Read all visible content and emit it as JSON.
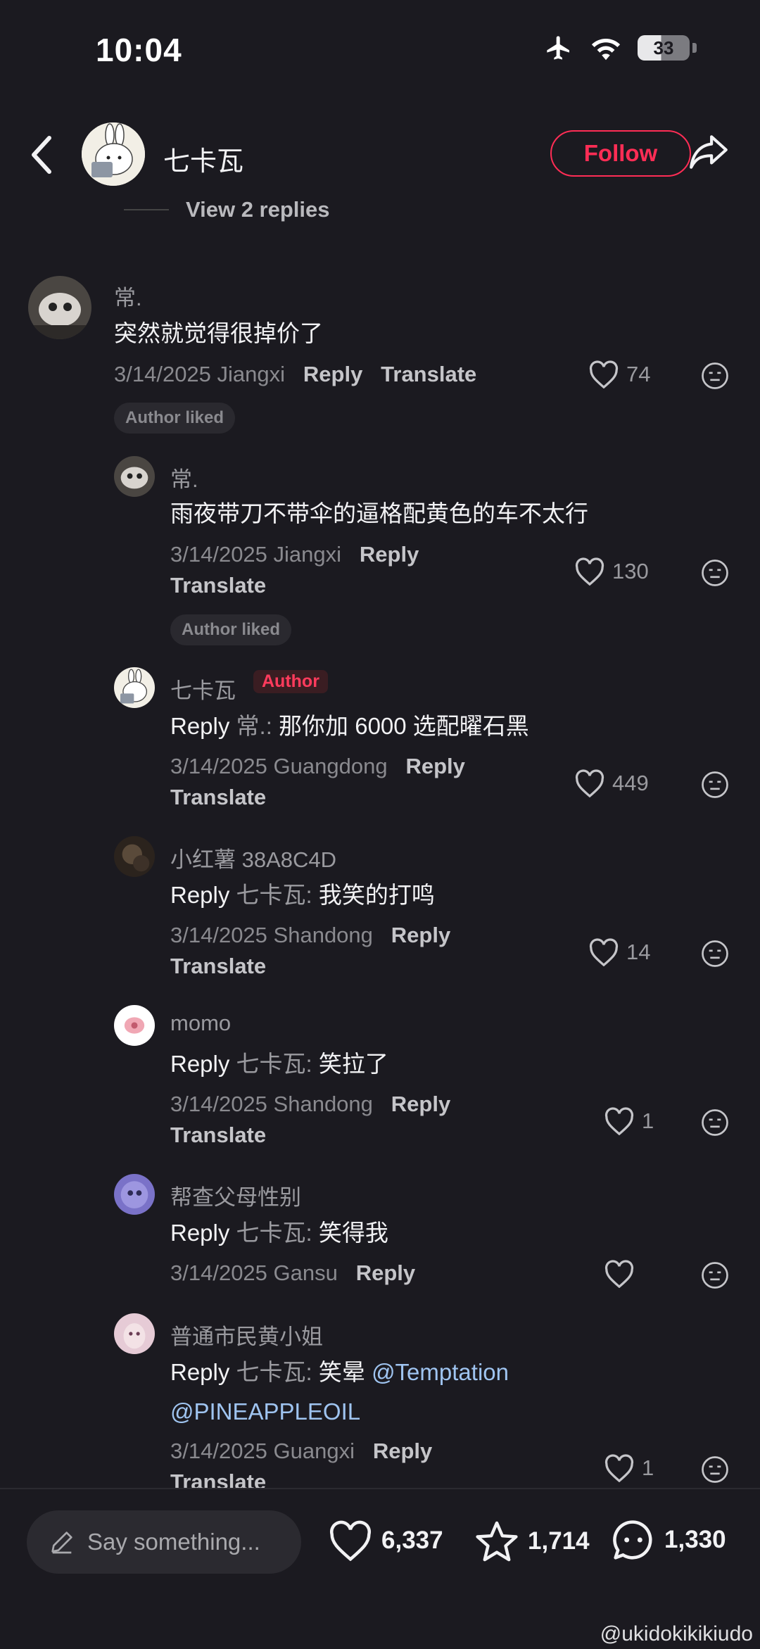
{
  "status_bar": {
    "time": "10:04",
    "battery": "33"
  },
  "header": {
    "username": "七卡瓦",
    "follow_label": "Follow"
  },
  "view_replies": "View 2 replies",
  "comments": [
    {
      "name": "常.",
      "text": "突然就觉得很掉价了",
      "date": "3/14/2025",
      "location": "Jiangxi",
      "likes": "74",
      "author_liked": "Author liked"
    },
    {
      "name": "常.",
      "text": "雨夜带刀不带伞的逼格配黄色的车不太行",
      "date": "3/14/2025",
      "location": "Jiangxi",
      "likes": "130",
      "author_liked": "Author liked"
    },
    {
      "name": "七卡瓦",
      "badge": "Author",
      "reply_target": "常.:",
      "text": " 那你加 6000 选配曜石黑",
      "date": "3/14/2025",
      "location": "Guangdong",
      "likes": "449"
    },
    {
      "name": "小红薯 38A8C4D",
      "reply_target": "七卡瓦:",
      "text": " 我笑的打鸣",
      "date": "3/14/2025",
      "location": "Shandong",
      "likes": "14"
    },
    {
      "name": "momo",
      "reply_target": "七卡瓦:",
      "text": " 笑拉了",
      "date": "3/14/2025",
      "location": "Shandong",
      "likes": "1"
    },
    {
      "name": "帮查父母性别",
      "reply_target": "七卡瓦:",
      "text": " 笑得我",
      "date": "3/14/2025",
      "location": "Gansu",
      "likes": ""
    },
    {
      "name": "普通市民黄小姐",
      "reply_target": "七卡瓦:",
      "text": " 笑晕 ",
      "mention1": "@Temptation",
      "mention2": "@PINEAPPLEOIL",
      "date": "3/14/2025",
      "location": "Guangxi",
      "likes": "1"
    }
  ],
  "labels": {
    "reply": "Reply",
    "translate": "Translate"
  },
  "bottom_bar": {
    "placeholder": "Say something...",
    "likes": "6,337",
    "favorites": "1,714",
    "comments": "1,330"
  },
  "watermark": "@ukidokikikiudo",
  "colors": {
    "background": "#1b1a20",
    "accent": "#ff2d55",
    "mention": "#9fc4f0"
  }
}
